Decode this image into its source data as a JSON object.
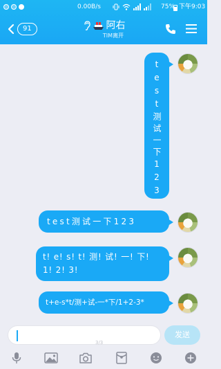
{
  "status_bar": {
    "net_speed": "0.00B/s",
    "battery": "75%",
    "time": "下午9:03"
  },
  "header": {
    "back_count": "91",
    "contact_name": "阿右",
    "contact_status": "TIM离开"
  },
  "messages": [
    {
      "text": "test测试一下123"
    },
    {
      "text": "test测试一下123"
    },
    {
      "text": "t! e! s! t! 测! 试! 一! 下! 1! 2! 3!"
    },
    {
      "text": "t+e-s*t/测+试-一*下/1+2-3*"
    }
  ],
  "input": {
    "value": "",
    "send_label": "发送",
    "page_indicator": "3/3"
  },
  "colors": {
    "header": "#1eb6f3",
    "bubble": "#1aa9f6",
    "send_disabled": "#b7e4f7",
    "background": "#ecedf4"
  },
  "icons": [
    "wifi-icon",
    "signal-icon",
    "back-chevron-icon",
    "ear-icon",
    "ship-icon",
    "phone-icon",
    "menu-icon",
    "mic-icon",
    "image-icon",
    "camera-icon",
    "red-packet-icon",
    "emoji-icon",
    "plus-icon"
  ]
}
